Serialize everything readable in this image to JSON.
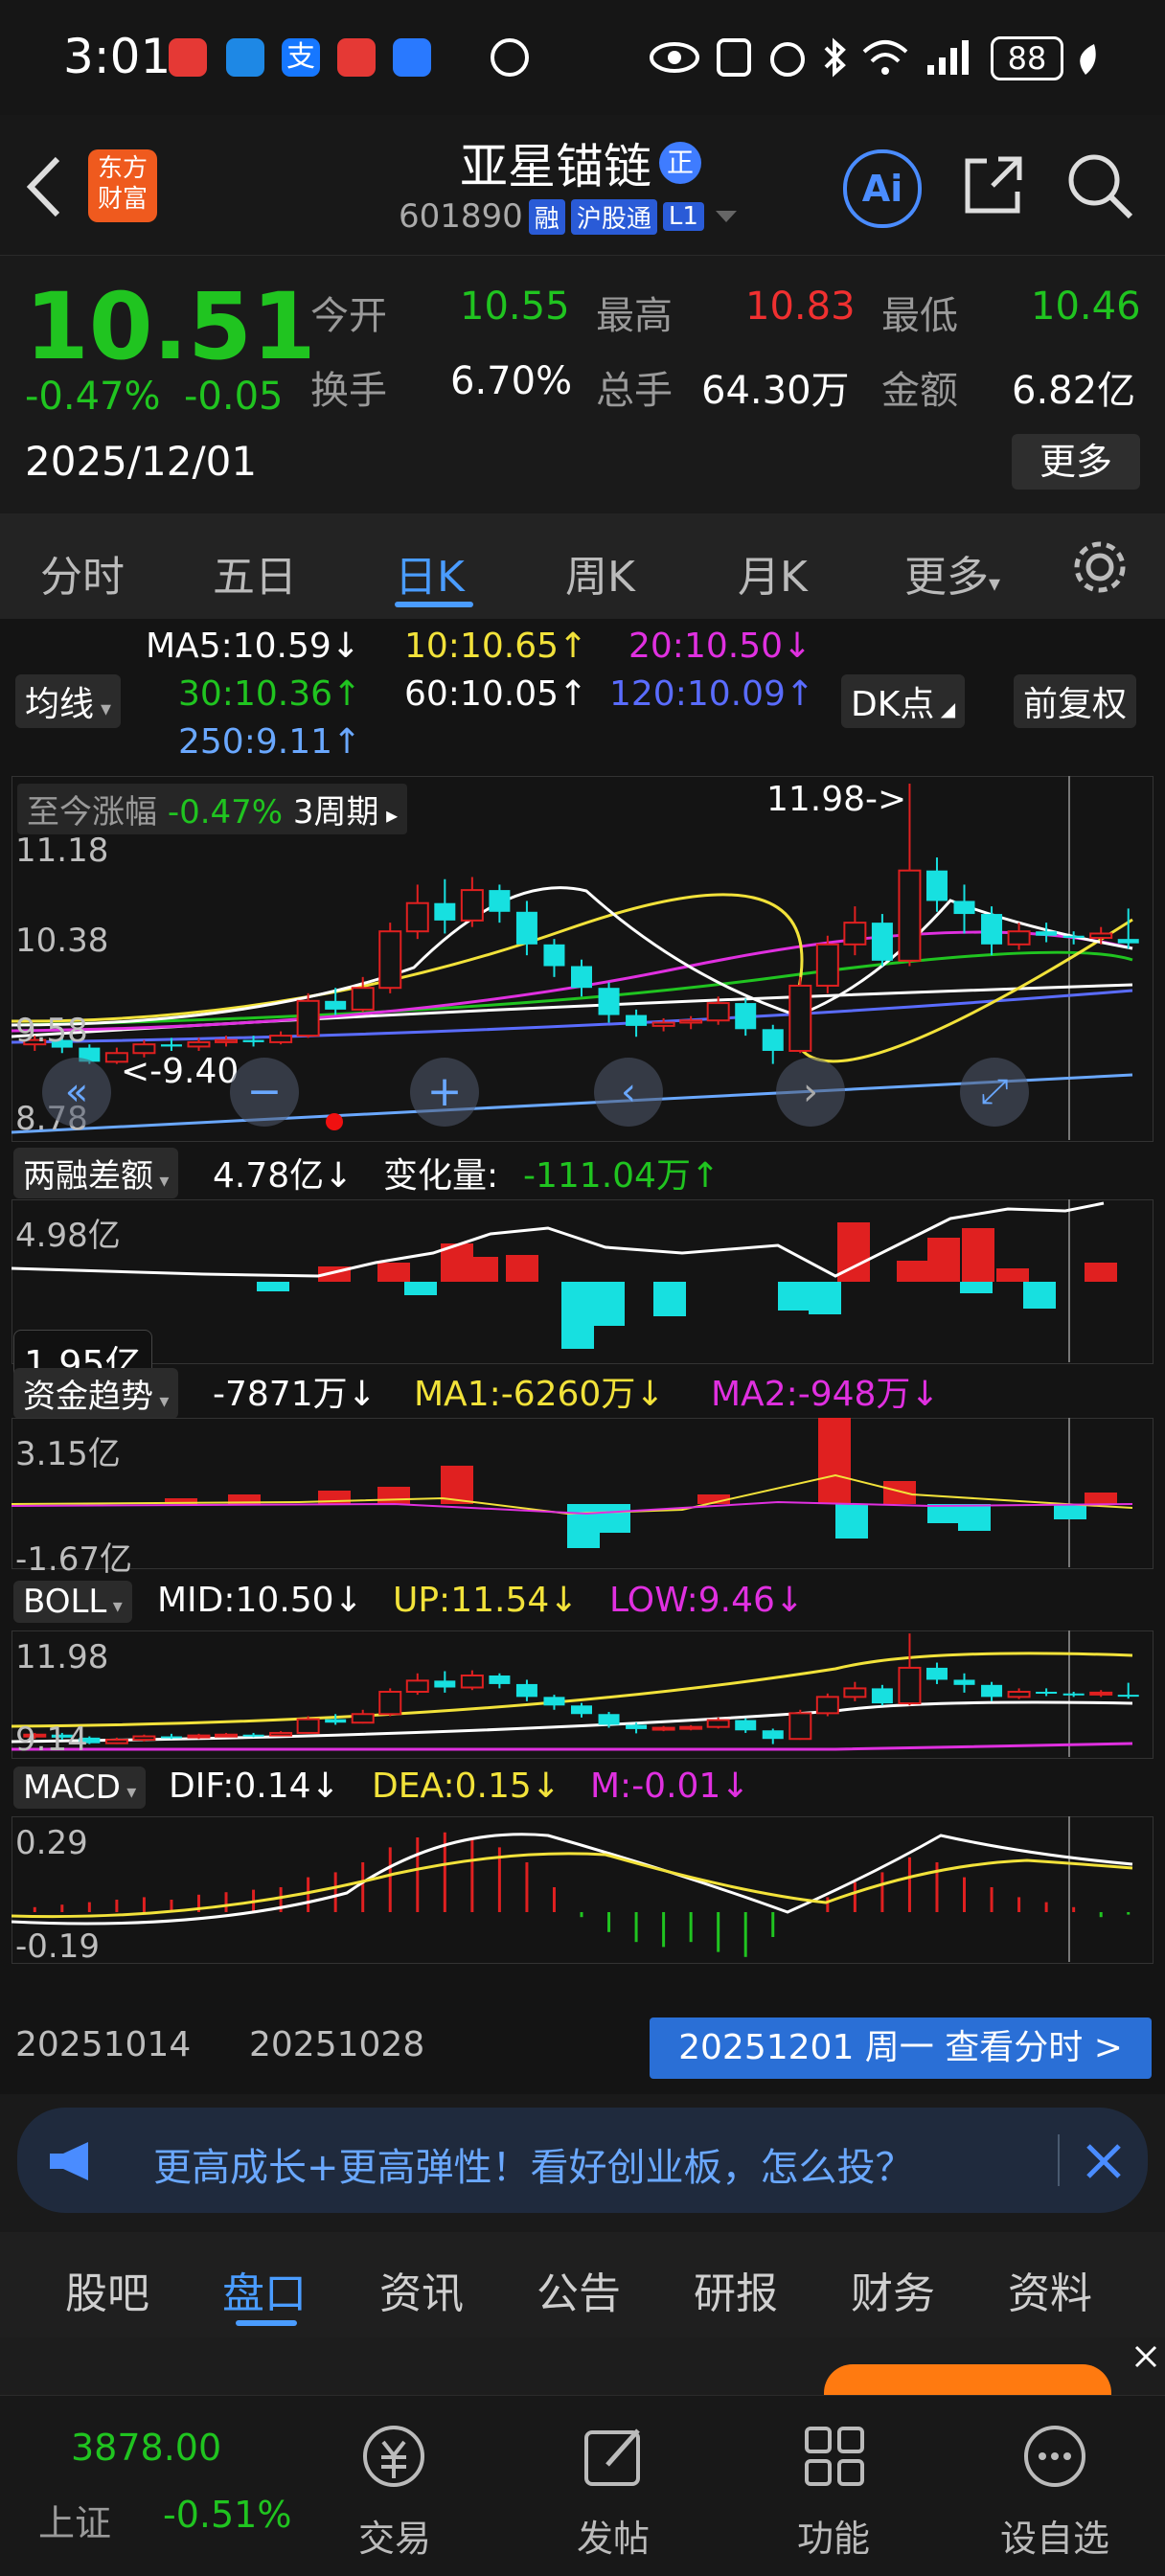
{
  "status": {
    "time": "3:01",
    "battery": "88"
  },
  "header": {
    "logo": "东方\n财富",
    "title": "亚星锚链",
    "title_badge": "正",
    "code": "601890",
    "badges": [
      "融",
      "沪股通",
      "L1"
    ],
    "ai_label": "Ai"
  },
  "quote": {
    "price": "10.51",
    "change_pct": "-0.47%",
    "change": "-0.05",
    "date": "2025/12/01",
    "open_label": "今开",
    "open": "10.55",
    "high_label": "最高",
    "high": "10.83",
    "low_label": "最低",
    "low": "10.46",
    "turnover_label": "换手",
    "turnover": "6.70%",
    "volume_label": "总手",
    "volume": "64.30万",
    "amount_label": "金额",
    "amount": "6.82亿",
    "more_label": "更多"
  },
  "period_tabs": [
    "分时",
    "五日",
    "日K",
    "周K",
    "月K",
    "更多"
  ],
  "active_period": "日K",
  "ma_legend": {
    "selector": "均线",
    "ma5": "MA5:10.59↓",
    "ma10": "10:10.65↑",
    "ma20": "20:10.50↓",
    "ma30": "30:10.36↑",
    "ma60": "60:10.05↑",
    "ma120": "120:10.09↑",
    "ma250": "250:9.11↑",
    "dk_label": "DK点",
    "fq_label": "前复权"
  },
  "main_chart": {
    "gain_label": "至今涨幅",
    "gain_value": "-0.47%",
    "gain_period": "3周期",
    "y_labels": [
      "11.18",
      "10.38",
      "9.58",
      "8.78"
    ],
    "high_annot": "11.98->",
    "low_annot": "<-9.40"
  },
  "margin": {
    "selector": "两融差额",
    "value": "4.78亿↓",
    "change_label": "变化量:",
    "change": "-111.04万↑",
    "y_top": "4.98亿",
    "y_bottom": "1.95亿"
  },
  "capital": {
    "selector": "资金趋势",
    "value": "-7871万↓",
    "ma1": "MA1:-6260万↓",
    "ma2": "MA2:-948万↓",
    "y_top": "3.15亿",
    "y_bottom": "-1.67亿"
  },
  "boll": {
    "selector": "BOLL",
    "mid": "MID:10.50↓",
    "up": "UP:11.54↓",
    "low": "LOW:9.46↓",
    "y_top": "11.98",
    "y_bottom": "9.14"
  },
  "macd": {
    "selector": "MACD",
    "dif": "DIF:0.14↓",
    "dea": "DEA:0.15↓",
    "m": "M:-0.01↓",
    "y_top": "0.29",
    "y_bottom": "-0.19"
  },
  "dates": {
    "d1": "20251014",
    "d2": "20251028",
    "tooltip": "20251201 周一 查看分时 >"
  },
  "banner": {
    "text": "更高成长+更高弹性！看好创业板，怎么投？"
  },
  "info_tabs": [
    "股吧",
    "盘口",
    "资讯",
    "公告",
    "研报",
    "财务",
    "资料"
  ],
  "active_info": "盘口",
  "bottom_nav": {
    "index_value": "3878.00",
    "index_name": "上证",
    "index_change": "-0.51%",
    "items": [
      "交易",
      "发帖",
      "功能",
      "设自选"
    ]
  },
  "chart_data": {
    "type": "candlestick",
    "candles": [
      {
        "o": 9.58,
        "c": 9.62,
        "h": 9.66,
        "l": 9.52
      },
      {
        "o": 9.62,
        "c": 9.55,
        "h": 9.66,
        "l": 9.5
      },
      {
        "o": 9.55,
        "c": 9.42,
        "h": 9.58,
        "l": 9.4
      },
      {
        "o": 9.42,
        "c": 9.5,
        "h": 9.55,
        "l": 9.4
      },
      {
        "o": 9.5,
        "c": 9.58,
        "h": 9.62,
        "l": 9.46
      },
      {
        "o": 9.58,
        "c": 9.56,
        "h": 9.64,
        "l": 9.52
      },
      {
        "o": 9.56,
        "c": 9.6,
        "h": 9.64,
        "l": 9.52
      },
      {
        "o": 9.6,
        "c": 9.62,
        "h": 9.66,
        "l": 9.56
      },
      {
        "o": 9.62,
        "c": 9.6,
        "h": 9.66,
        "l": 9.56
      },
      {
        "o": 9.6,
        "c": 9.66,
        "h": 9.7,
        "l": 9.58
      },
      {
        "o": 9.66,
        "c": 9.98,
        "h": 10.05,
        "l": 9.64
      },
      {
        "o": 9.98,
        "c": 9.9,
        "h": 10.1,
        "l": 9.85
      },
      {
        "o": 9.9,
        "c": 10.1,
        "h": 10.2,
        "l": 9.88
      },
      {
        "o": 10.1,
        "c": 10.62,
        "h": 10.7,
        "l": 10.05
      },
      {
        "o": 10.62,
        "c": 10.88,
        "h": 11.05,
        "l": 10.55
      },
      {
        "o": 10.88,
        "c": 10.72,
        "h": 11.1,
        "l": 10.6
      },
      {
        "o": 10.72,
        "c": 11.0,
        "h": 11.12,
        "l": 10.66
      },
      {
        "o": 11.0,
        "c": 10.8,
        "h": 11.05,
        "l": 10.7
      },
      {
        "o": 10.8,
        "c": 10.5,
        "h": 10.9,
        "l": 10.4
      },
      {
        "o": 10.5,
        "c": 10.3,
        "h": 10.55,
        "l": 10.2
      },
      {
        "o": 10.3,
        "c": 10.1,
        "h": 10.36,
        "l": 10.02
      },
      {
        "o": 10.1,
        "c": 9.85,
        "h": 10.15,
        "l": 9.78
      },
      {
        "o": 9.85,
        "c": 9.75,
        "h": 9.9,
        "l": 9.65
      },
      {
        "o": 9.75,
        "c": 9.78,
        "h": 9.82,
        "l": 9.7
      },
      {
        "o": 9.78,
        "c": 9.8,
        "h": 9.84,
        "l": 9.72
      },
      {
        "o": 9.8,
        "c": 9.96,
        "h": 10.02,
        "l": 9.76
      },
      {
        "o": 9.96,
        "c": 9.72,
        "h": 10.0,
        "l": 9.66
      },
      {
        "o": 9.72,
        "c": 9.52,
        "h": 9.76,
        "l": 9.4
      },
      {
        "o": 9.52,
        "c": 10.12,
        "h": 10.2,
        "l": 9.5
      },
      {
        "o": 10.12,
        "c": 10.5,
        "h": 10.58,
        "l": 10.05
      },
      {
        "o": 10.5,
        "c": 10.7,
        "h": 10.85,
        "l": 10.4
      },
      {
        "o": 10.7,
        "c": 10.35,
        "h": 10.78,
        "l": 10.3
      },
      {
        "o": 10.35,
        "c": 11.18,
        "h": 11.98,
        "l": 10.3
      },
      {
        "o": 11.18,
        "c": 10.9,
        "h": 11.3,
        "l": 10.8
      },
      {
        "o": 10.9,
        "c": 10.78,
        "h": 11.05,
        "l": 10.6
      },
      {
        "o": 10.78,
        "c": 10.5,
        "h": 10.85,
        "l": 10.4
      },
      {
        "o": 10.5,
        "c": 10.62,
        "h": 10.7,
        "l": 10.45
      },
      {
        "o": 10.62,
        "c": 10.58,
        "h": 10.7,
        "l": 10.52
      },
      {
        "o": 10.58,
        "c": 10.56,
        "h": 10.62,
        "l": 10.5
      },
      {
        "o": 10.56,
        "c": 10.6,
        "h": 10.66,
        "l": 10.5
      },
      {
        "o": 10.55,
        "c": 10.51,
        "h": 10.83,
        "l": 10.46
      }
    ]
  }
}
